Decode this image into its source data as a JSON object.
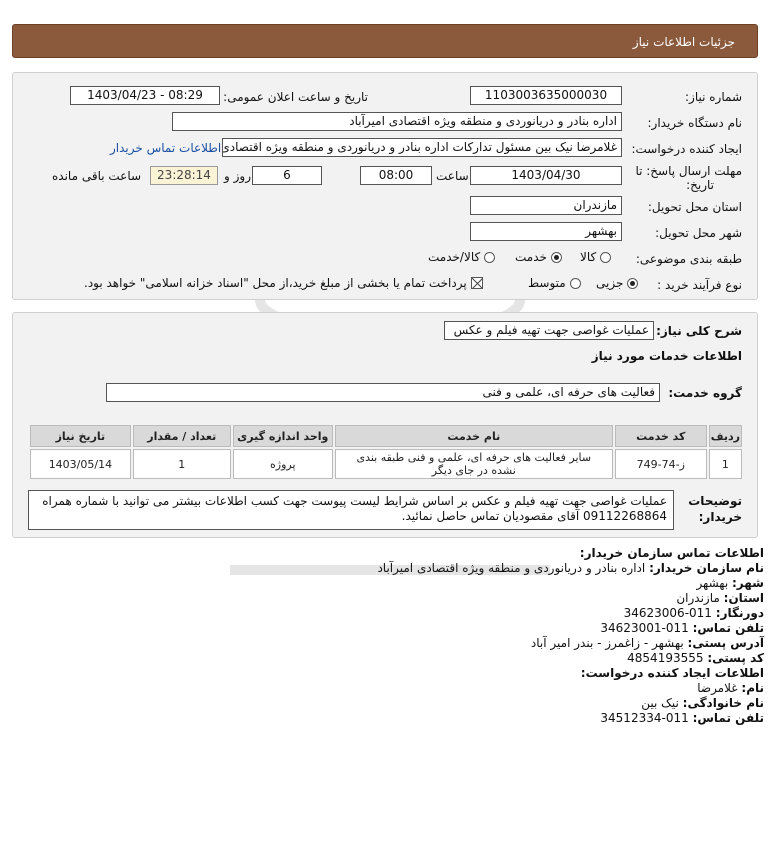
{
  "header": {
    "title": "جزئیات اطلاعات نیاز"
  },
  "need_info": {
    "need_number_label": "شماره نیاز:",
    "need_number": "1103003635000030",
    "announce_label": "تاریخ و ساعت اعلان عمومی:",
    "announce_value": "1403/04/23 - 08:29",
    "buyer_label": "نام دستگاه خریدار:",
    "buyer_value": "اداره بنادر و دریانوردی و منطقه ویژه اقتصادی امیرآباد",
    "creator_label": "ایجاد کننده درخواست:",
    "creator_value": "غلامرضا نیک بین مسئول تدارکات اداره بنادر و دریانوردی و منطقه ویژه اقتصادی اد",
    "contact_link": "اطلاعات تماس خریدار",
    "deadline_label_1": "مهلت ارسال پاسخ: تا",
    "deadline_label_2": "تاریخ:",
    "deadline_date": "1403/04/30",
    "time_label": "ساعت",
    "deadline_time": "08:00",
    "days_value": "6",
    "days_label": "روز و",
    "remaining_time": "23:28:14",
    "remaining_label": "ساعت باقی مانده",
    "province_label": "استان محل تحویل:",
    "province_value": "مازندران",
    "city_label": "شهر محل تحویل:",
    "city_value": "بهشهر",
    "category_label": "طبقه بندی موضوعی:",
    "category_options": [
      "کالا",
      "خدمت",
      "کالا/خدمت"
    ],
    "category_selected": "خدمت",
    "process_label": "نوع فرآیند خرید :",
    "process_options": [
      "جزیی",
      "متوسط"
    ],
    "process_selected": "جزیی",
    "payment_note": "پرداخت تمام یا بخشی از مبلغ خرید،از محل \"اسناد خزانه اسلامی\" خواهد بود."
  },
  "summary": {
    "general_desc_label": "شرح کلی نیاز:",
    "general_desc_value": "عملیات غواصی جهت تهیه فیلم و عکس",
    "services_heading": "اطلاعات خدمات مورد نیاز",
    "service_group_label": "گروه خدمت:",
    "service_group_value": "فعالیت های حرفه ای، علمی و فنی"
  },
  "table": {
    "headers": [
      "ردیف",
      "کد خدمت",
      "نام خدمت",
      "واحد اندازه گیری",
      "تعداد / مقدار",
      "تاریخ نیاز"
    ],
    "rows": [
      [
        "1",
        "ز-74-749",
        "سایر فعالیت های حرفه ای، علمی و فنی طبقه بندی نشده در جای دیگر",
        "پروژه",
        "1",
        "1403/05/14"
      ]
    ]
  },
  "buyer_notes": {
    "label_1": "توضیحات",
    "label_2": "خریدار:",
    "text": "عملیات غواصی جهت تهیه فیلم و عکس بر اساس شرایط لیست پیوست جهت کسب اطلاعات بیشتر می توانید با شماره همراه 09112268864 آقای مقصودیان تماس حاصل نمائید."
  },
  "buyer_contact": {
    "heading": "اطلاعات تماس سازمان خریدار:",
    "org_label": "نام سازمان خریدار:",
    "org_value": "اداره بنادر و دریانوردی و منطقه ویژه اقتصادی امیرآباد",
    "city_label": "شهر:",
    "city_value": "بهشهر",
    "province_label": "استان:",
    "province_value": "مازندران",
    "fax_label": "دورنگار:",
    "fax_value": "011-34623006",
    "phone_label": "تلفن تماس:",
    "phone_value": "011-34623001",
    "address_label": "آدرس پستی:",
    "address_value": "بهشهر - زاغمرز - بندر امیر آباد",
    "postal_label": "کد پستی:",
    "postal_value": "4854193555"
  },
  "creator_contact": {
    "heading": "اطلاعات ایجاد کننده درخواست:",
    "name_label": "نام:",
    "name_value": "غلامرضا",
    "family_label": "نام خانوادگی:",
    "family_value": "نیک بین",
    "phone_label": "تلفن تماس:",
    "phone_value": "011-34512334"
  }
}
